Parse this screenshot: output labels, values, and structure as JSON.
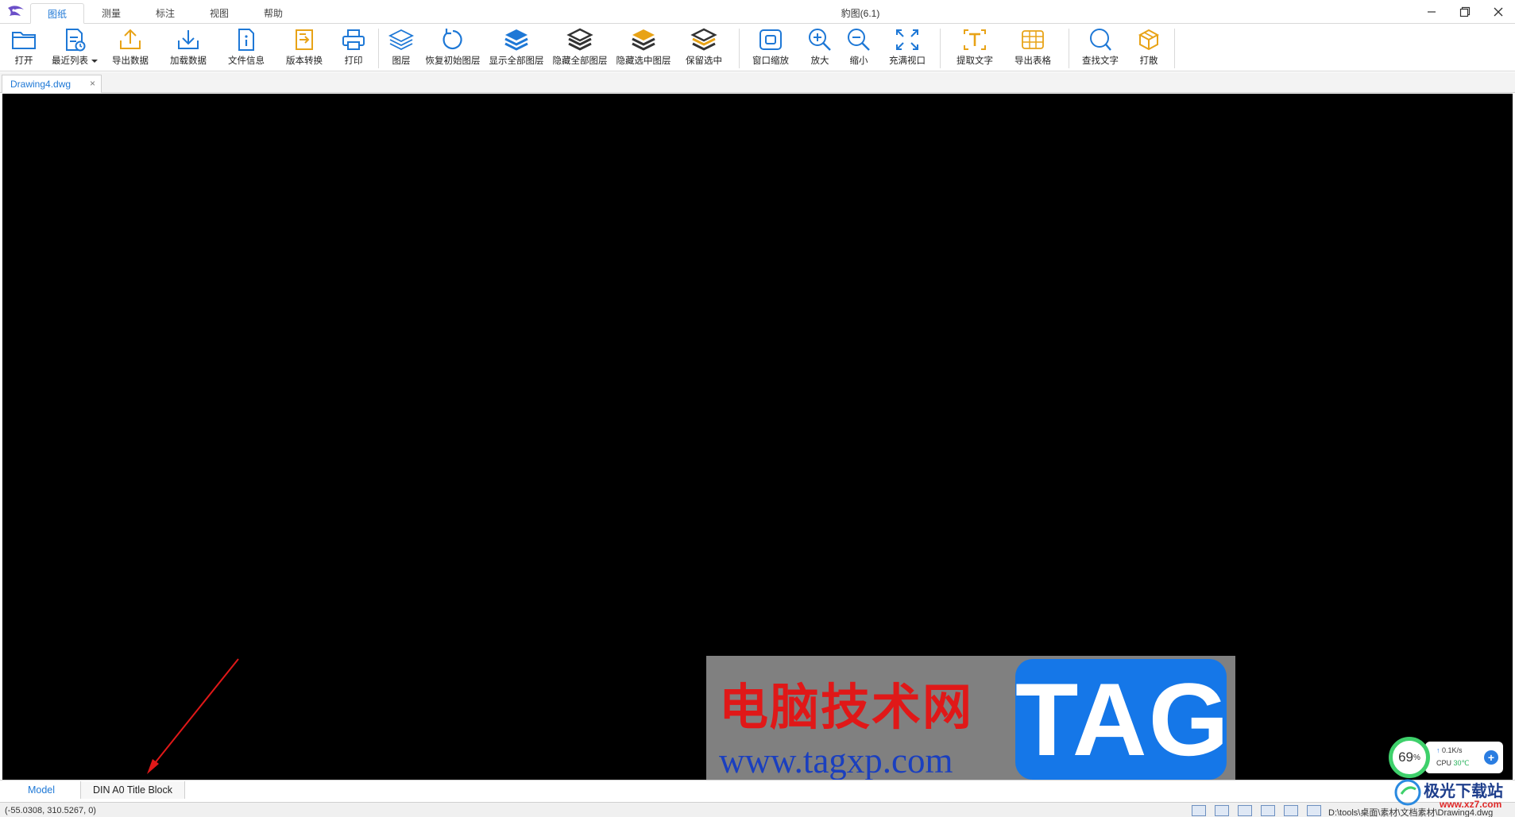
{
  "app": {
    "title": "豹图(6.1)"
  },
  "menu": {
    "tabs": [
      "图纸",
      "测量",
      "标注",
      "视图",
      "帮助"
    ],
    "active": "图纸"
  },
  "toolbar": {
    "open": "打开",
    "recent": "最近列表",
    "export_data": "导出数据",
    "load_data": "加载数据",
    "file_info": "文件信息",
    "version_convert": "版本转换",
    "print": "打印",
    "layers": "图层",
    "restore_layers": "恢复初始图层",
    "show_all_layers": "显示全部图层",
    "hide_all_layers": "隐藏全部图层",
    "hide_selected_layers": "隐藏选中图层",
    "keep_selected": "保留选中",
    "window_zoom": "窗口缩放",
    "zoom_in": "放大",
    "zoom_out": "缩小",
    "fit_view": "充满视口",
    "extract_text": "提取文字",
    "export_table": "导出表格",
    "find_text": "查找文字",
    "explode": "打散"
  },
  "document": {
    "tab_name": "Drawing4.dwg"
  },
  "layouts": {
    "tabs": [
      "Model",
      "DIN A0 Title Block"
    ],
    "active": "Model"
  },
  "status": {
    "coords": "(-55.0308, 310.5267, 0)",
    "path": "D:\\tools\\桌面\\素材\\文档素材\\Drawing4.dwg"
  },
  "watermark": {
    "cn_text": "电脑技术网",
    "url": "www.tagxp.com",
    "tag": "TAG"
  },
  "net_widget": {
    "percent": "69",
    "percent_unit": "%",
    "speed": "0.1K/s",
    "cpu_label": "CPU",
    "cpu_temp": "30℃"
  },
  "site_watermark": {
    "name": "极光下载站",
    "url": "www.xz7.com"
  },
  "colors": {
    "accent": "#1e78d6",
    "canvas_bg": "#000000",
    "layer_yellow": "#e8a317",
    "annotation_red": "#e01818"
  }
}
